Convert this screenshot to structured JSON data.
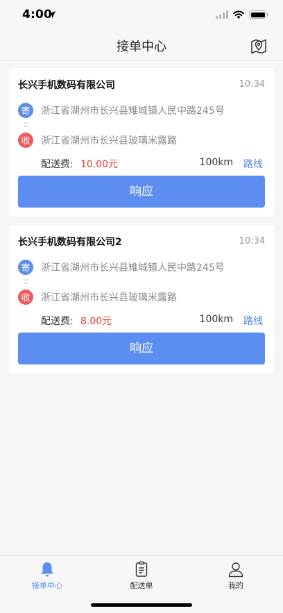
{
  "status_bar": {
    "time": "4:00"
  },
  "nav": {
    "title": "接单中心",
    "right_icon": "map-pin-icon"
  },
  "orders": [
    {
      "company": "长兴手机数码有限公司",
      "time": "10:34",
      "sender_badge": "寄",
      "sender_address": "浙江省湖州市长兴县雉城镇人民中路245号",
      "receiver_badge": "收",
      "receiver_address": "浙江省湖州市长兴县玻璃米露路",
      "fee_label": "配送费:",
      "fee_value": "10.00元",
      "distance": "100km",
      "route_label": "路线",
      "action_label": "响应"
    },
    {
      "company": "长兴手机数码有限公司2",
      "time": "10:34",
      "sender_badge": "寄",
      "sender_address": "浙江省湖州市长兴县雉城镇人民中路245号",
      "receiver_badge": "收",
      "receiver_address": "浙江省湖州市长兴县玻璃米露路",
      "fee_label": "配送费:",
      "fee_value": "8.00元",
      "distance": "100km",
      "route_label": "路线",
      "action_label": "响应"
    }
  ],
  "tabs": [
    {
      "label": "接单中心",
      "icon": "bell-icon",
      "active": true
    },
    {
      "label": "配送单",
      "icon": "clipboard-icon",
      "active": false
    },
    {
      "label": "我的",
      "icon": "person-icon",
      "active": false
    }
  ],
  "colors": {
    "accent": "#5b8ef0",
    "sender_badge": "#5a8de6",
    "receiver_badge": "#ec5a5a",
    "fee": "#e53935",
    "route": "#4a84df"
  }
}
